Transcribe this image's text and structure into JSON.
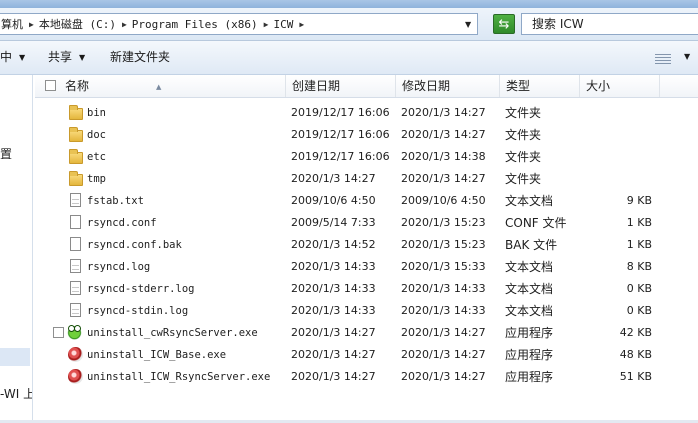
{
  "address": {
    "crumbs": [
      "算机",
      "本地磁盘 (C:)",
      "Program Files (x86)",
      "ICW"
    ],
    "refresh_icon": "refresh-arrows-icon"
  },
  "search": {
    "text": "搜索 ICW"
  },
  "toolbar": {
    "partial": "中",
    "share": "共享",
    "new_folder": "新建文件夹"
  },
  "nav": {
    "item1": "置",
    "item2": "-WI 上"
  },
  "headers": {
    "name": "名称",
    "created": "创建日期",
    "modified": "修改日期",
    "type": "类型",
    "size": "大小"
  },
  "files": [
    {
      "name": "bin",
      "created": "2019/12/17 16:06",
      "modified": "2020/1/3 14:27",
      "type": "文件夹",
      "size": "",
      "icon": "folder-icon"
    },
    {
      "name": "doc",
      "created": "2019/12/17 16:06",
      "modified": "2020/1/3 14:27",
      "type": "文件夹",
      "size": "",
      "icon": "folder-icon"
    },
    {
      "name": "etc",
      "created": "2019/12/17 16:06",
      "modified": "2020/1/3 14:38",
      "type": "文件夹",
      "size": "",
      "icon": "folder-icon"
    },
    {
      "name": "tmp",
      "created": "2020/1/3 14:27",
      "modified": "2020/1/3 14:27",
      "type": "文件夹",
      "size": "",
      "icon": "folder-icon"
    },
    {
      "name": "fstab.txt",
      "created": "2009/10/6 4:50",
      "modified": "2009/10/6 4:50",
      "type": "文本文档",
      "size": "9 KB",
      "icon": "text-document-icon"
    },
    {
      "name": "rsyncd.conf",
      "created": "2009/5/14 7:33",
      "modified": "2020/1/3 15:23",
      "type": "CONF 文件",
      "size": "1 KB",
      "icon": "blank-file-icon"
    },
    {
      "name": "rsyncd.conf.bak",
      "created": "2020/1/3 14:52",
      "modified": "2020/1/3 15:23",
      "type": "BAK 文件",
      "size": "1 KB",
      "icon": "blank-file-icon"
    },
    {
      "name": "rsyncd.log",
      "created": "2020/1/3 14:33",
      "modified": "2020/1/3 15:33",
      "type": "文本文档",
      "size": "8 KB",
      "icon": "text-document-icon"
    },
    {
      "name": "rsyncd-stderr.log",
      "created": "2020/1/3 14:33",
      "modified": "2020/1/3 14:33",
      "type": "文本文档",
      "size": "0 KB",
      "icon": "text-document-icon"
    },
    {
      "name": "rsyncd-stdin.log",
      "created": "2020/1/3 14:33",
      "modified": "2020/1/3 14:33",
      "type": "文本文档",
      "size": "0 KB",
      "icon": "text-document-icon"
    },
    {
      "name": "uninstall_cwRsyncServer.exe",
      "created": "2020/1/3 14:27",
      "modified": "2020/1/3 14:27",
      "type": "应用程序",
      "size": "42 KB",
      "icon": "frog-app-icon"
    },
    {
      "name": "uninstall_ICW_Base.exe",
      "created": "2020/1/3 14:27",
      "modified": "2020/1/3 14:27",
      "type": "应用程序",
      "size": "48 KB",
      "icon": "setup-app-icon"
    },
    {
      "name": "uninstall_ICW_RsyncServer.exe",
      "created": "2020/1/3 14:27",
      "modified": "2020/1/3 14:27",
      "type": "应用程序",
      "size": "51 KB",
      "icon": "setup-app-icon"
    }
  ]
}
